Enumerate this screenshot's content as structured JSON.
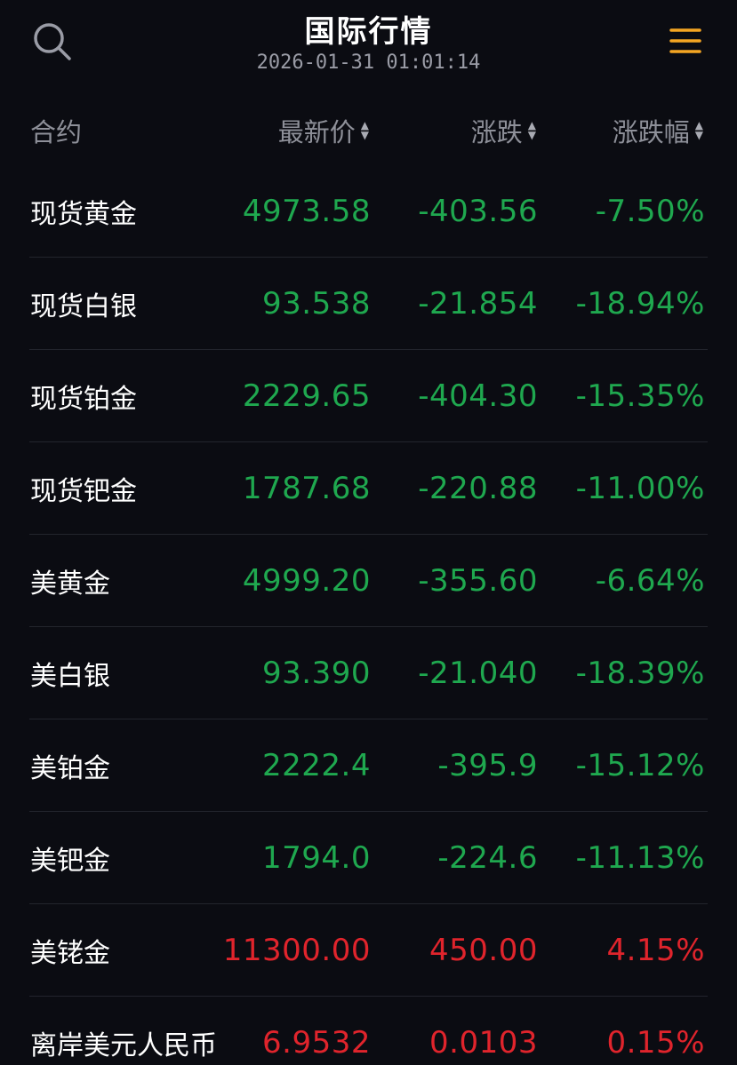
{
  "header": {
    "title": "国际行情",
    "timestamp": "2026-01-31 01:01:14",
    "search_icon": "search-icon",
    "menu_icon": "menu-icon",
    "menu_color": "#f5a623"
  },
  "table": {
    "columns": {
      "name": "合约",
      "price": "最新价",
      "change": "涨跌",
      "pct": "涨跌幅"
    },
    "sort_icon": "sort-updown-icon",
    "colors": {
      "down": "#1fa84f",
      "up": "#e0242c"
    },
    "rows": [
      {
        "name": "现货黄金",
        "price": "4973.58",
        "change": "-403.56",
        "pct": "-7.50%",
        "dir": "down"
      },
      {
        "name": "现货白银",
        "price": "93.538",
        "change": "-21.854",
        "pct": "-18.94%",
        "dir": "down"
      },
      {
        "name": "现货铂金",
        "price": "2229.65",
        "change": "-404.30",
        "pct": "-15.35%",
        "dir": "down"
      },
      {
        "name": "现货钯金",
        "price": "1787.68",
        "change": "-220.88",
        "pct": "-11.00%",
        "dir": "down"
      },
      {
        "name": "美黄金",
        "price": "4999.20",
        "change": "-355.60",
        "pct": "-6.64%",
        "dir": "down"
      },
      {
        "name": "美白银",
        "price": "93.390",
        "change": "-21.040",
        "pct": "-18.39%",
        "dir": "down"
      },
      {
        "name": "美铂金",
        "price": "2222.4",
        "change": "-395.9",
        "pct": "-15.12%",
        "dir": "down"
      },
      {
        "name": "美钯金",
        "price": "1794.0",
        "change": "-224.6",
        "pct": "-11.13%",
        "dir": "down"
      },
      {
        "name": "美铑金",
        "price": "11300.00",
        "change": "450.00",
        "pct": "4.15%",
        "dir": "up"
      },
      {
        "name": "离岸美元人民币",
        "price": "6.9532",
        "change": "0.0103",
        "pct": "0.15%",
        "dir": "up"
      }
    ]
  }
}
